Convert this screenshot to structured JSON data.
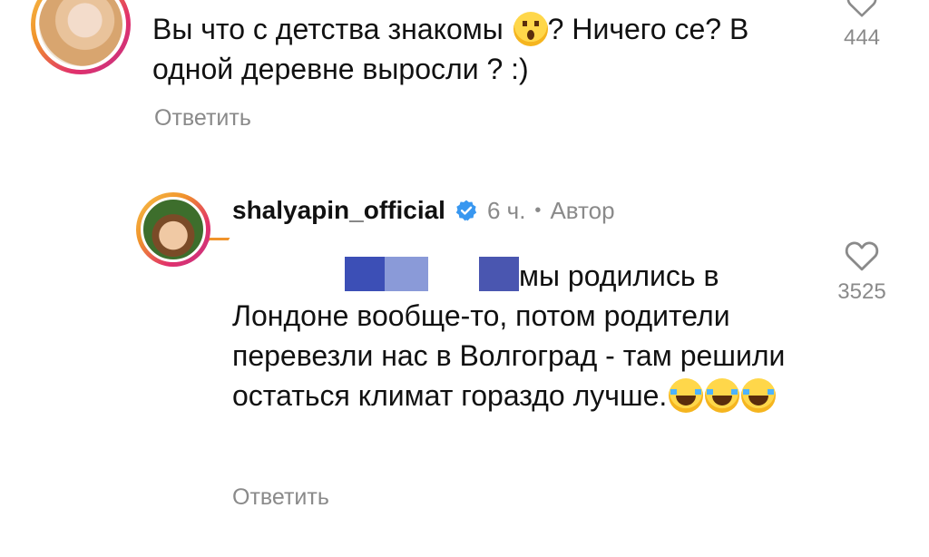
{
  "comment_1": {
    "text_part1": "Вы что с детства знакомы ",
    "emoji_1": "astonished-face-emoji",
    "text_part2": "? Ничего се? В одной деревне выросли ? :)",
    "reply_label": "Ответить",
    "like_count": "444"
  },
  "comment_2": {
    "username": "shalyapin_official",
    "time": "6 ч.",
    "separator": "•",
    "author_badge": "Автор",
    "text_part1": "мы родились в Лондоне вообще-то, потом родители перевезли нас в Волгоград - там решили остаться климат гораздо лучше.",
    "emoji": "face-with-tears-of-joy-emoji",
    "emoji_count": 3,
    "reply_label": "Ответить",
    "like_count": "3525"
  },
  "colors": {
    "text": "#111111",
    "muted": "#8a8a8a",
    "verified": "#3897f0",
    "ring_start": "#f7c14b",
    "ring_end": "#c13584"
  }
}
